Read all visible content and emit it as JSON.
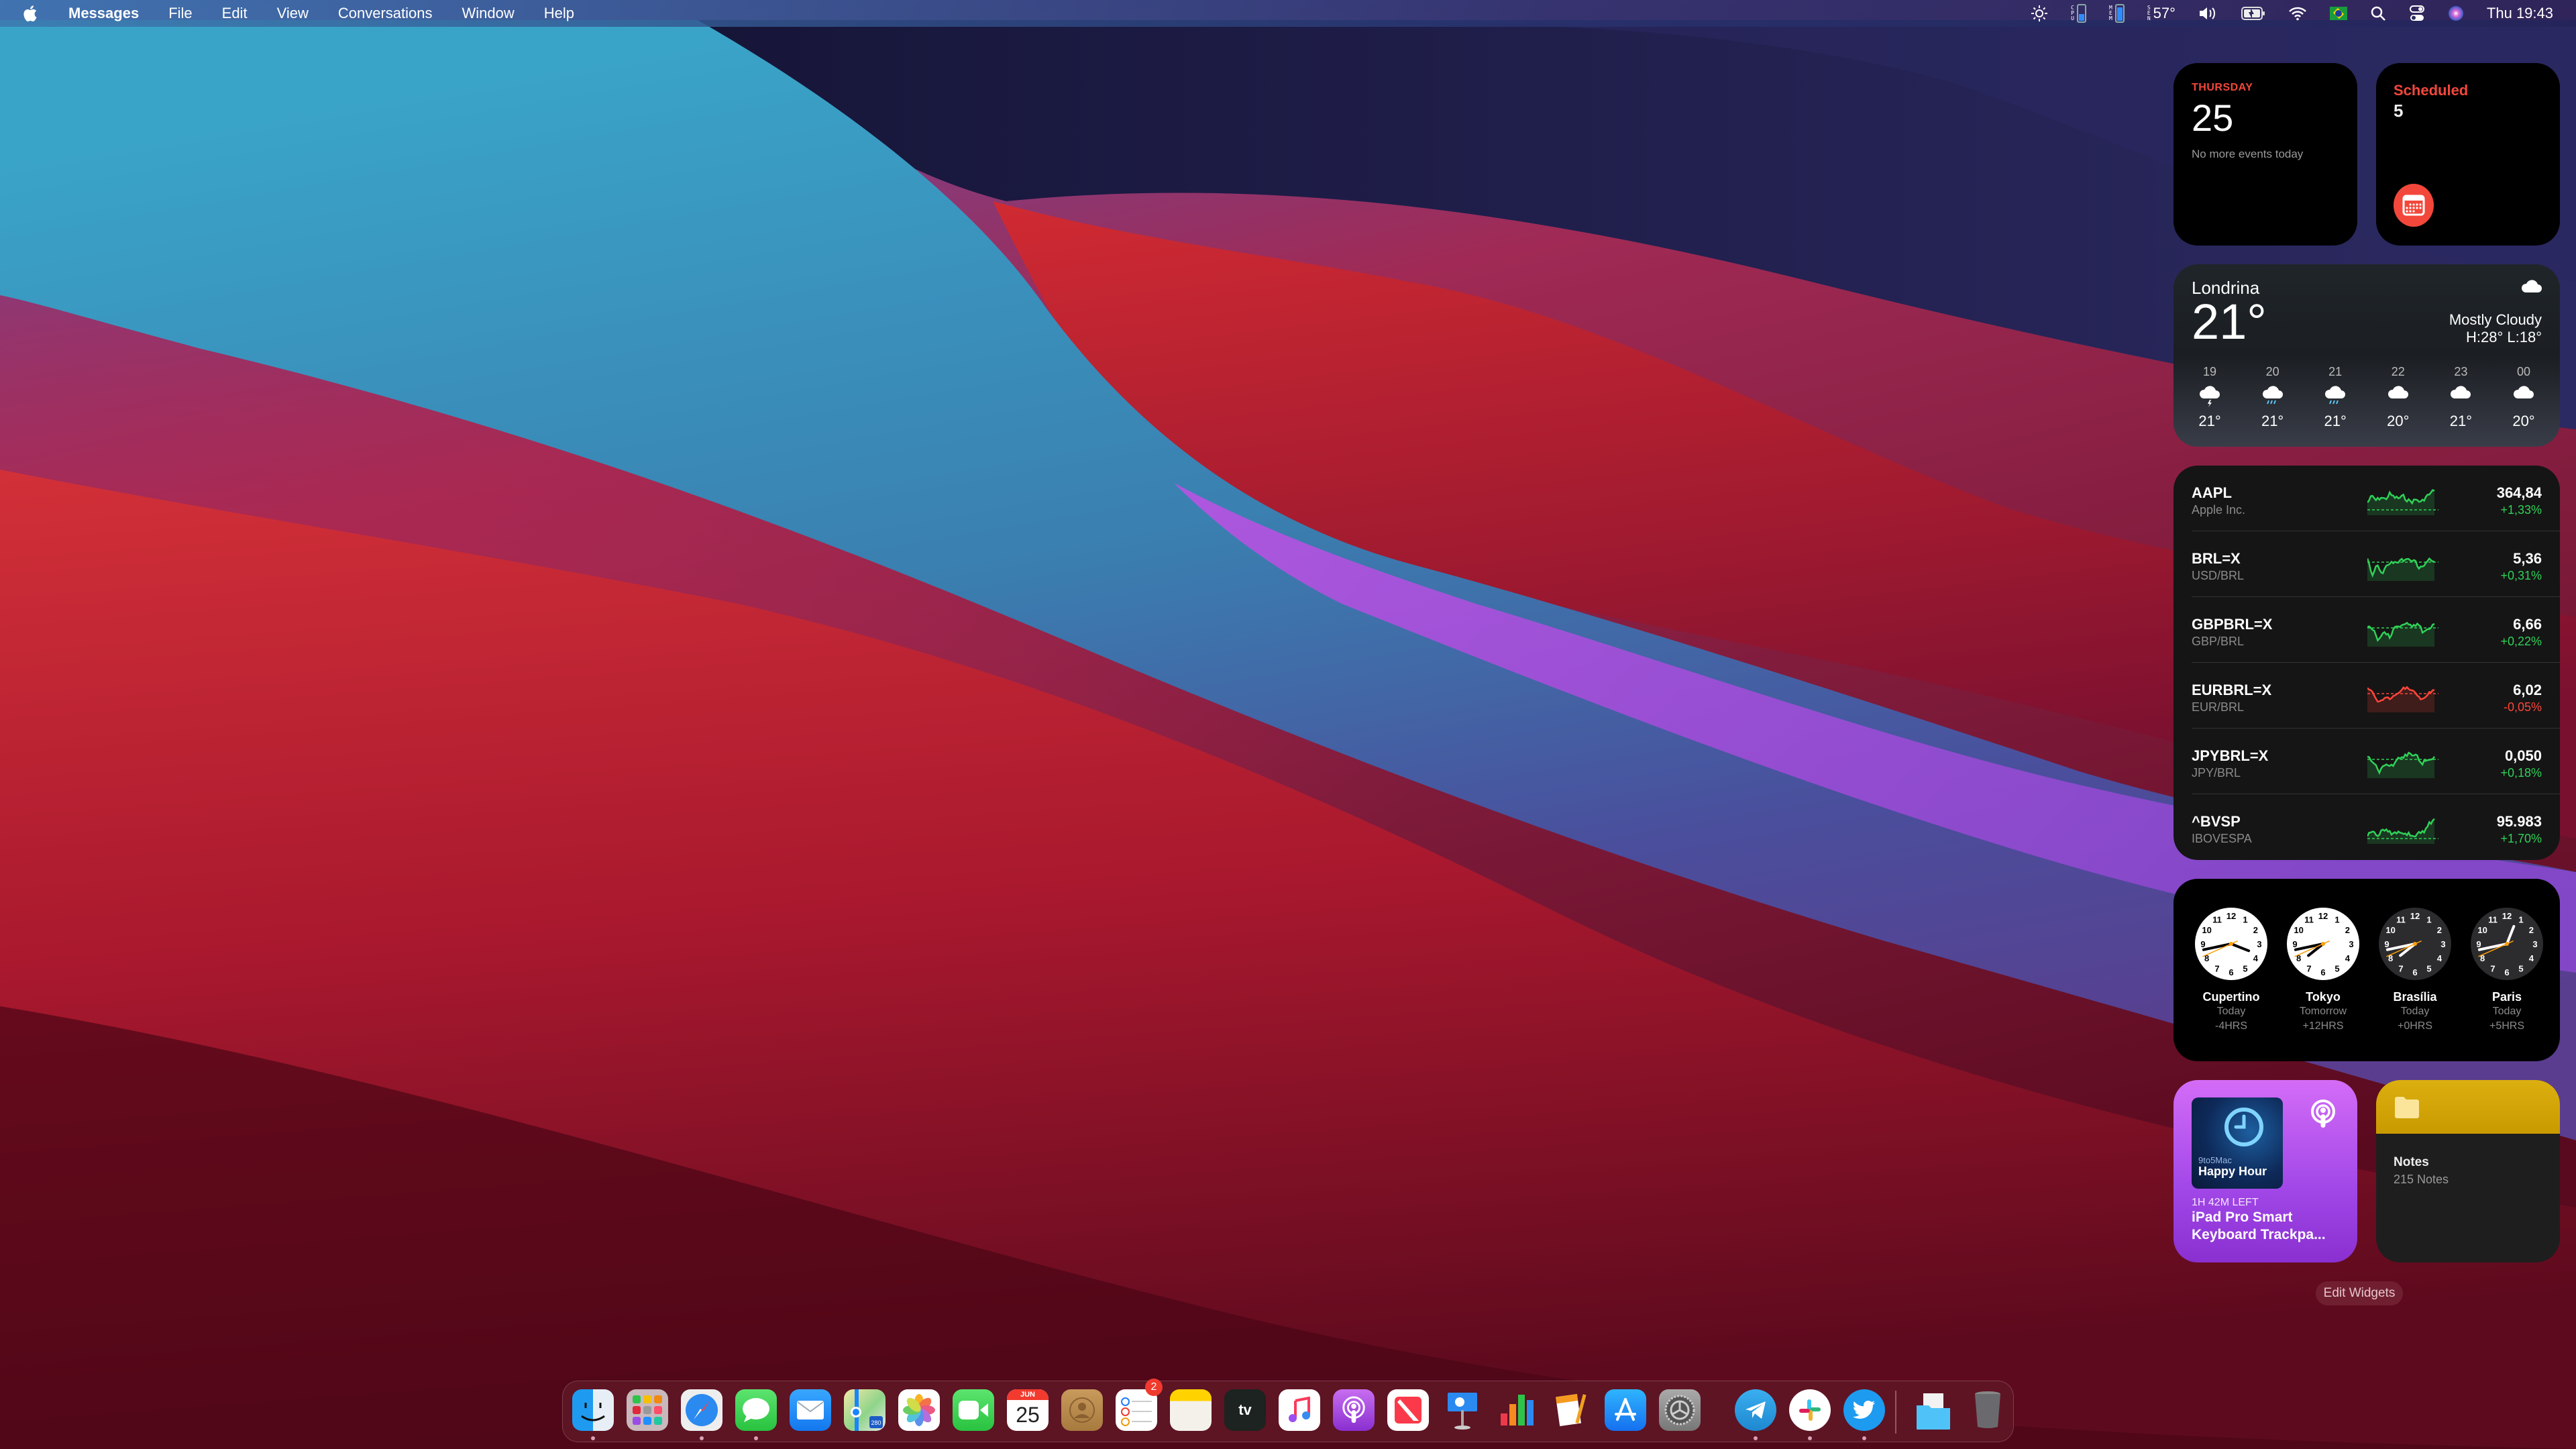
{
  "menubar": {
    "app_name": "Messages",
    "menus": [
      "File",
      "Edit",
      "View",
      "Conversations",
      "Window",
      "Help"
    ],
    "status": {
      "cpu_label": "CPU",
      "mem_label": "MEM",
      "sen_label": "SEN",
      "temperature": "57°",
      "clock": "Thu 19:43"
    },
    "icons": [
      "brightness-icon",
      "cpu-meter-icon",
      "memory-meter-icon",
      "sensor-temp-icon",
      "volume-icon",
      "battery-charging-icon",
      "wifi-icon",
      "brazil-flag-input-icon",
      "spotlight-search-icon",
      "control-center-icon",
      "siri-icon"
    ]
  },
  "widgets": {
    "calendar": {
      "weekday": "THURSDAY",
      "day": "25",
      "subtitle": "No more events today"
    },
    "reminders": {
      "list": "Scheduled",
      "count": "5",
      "accent": "#f3473b"
    },
    "weather": {
      "city": "Londrina",
      "temperature": "21°",
      "condition": "Mostly Cloudy",
      "high_low": "H:28° L:18°",
      "hourly": [
        {
          "hour": "19",
          "icon": "thunderstorm",
          "temp": "21°"
        },
        {
          "hour": "20",
          "icon": "rain",
          "temp": "21°"
        },
        {
          "hour": "21",
          "icon": "rain",
          "temp": "21°"
        },
        {
          "hour": "22",
          "icon": "cloud",
          "temp": "20°"
        },
        {
          "hour": "23",
          "icon": "cloud",
          "temp": "21°"
        },
        {
          "hour": "00",
          "icon": "cloud",
          "temp": "20°"
        }
      ]
    },
    "stocks": {
      "up_color": "#30d158",
      "down_color": "#ff453a",
      "items": [
        {
          "symbol": "AAPL",
          "name": "Apple Inc.",
          "price": "364,84",
          "change": "+1,33%",
          "direction": "up"
        },
        {
          "symbol": "BRL=X",
          "name": "USD/BRL",
          "price": "5,36",
          "change": "+0,31%",
          "direction": "up"
        },
        {
          "symbol": "GBPBRL=X",
          "name": "GBP/BRL",
          "price": "6,66",
          "change": "+0,22%",
          "direction": "up"
        },
        {
          "symbol": "EURBRL=X",
          "name": "EUR/BRL",
          "price": "6,02",
          "change": "-0,05%",
          "direction": "down"
        },
        {
          "symbol": "JPYBRL=X",
          "name": "JPY/BRL",
          "price": "0,050",
          "change": "+0,18%",
          "direction": "up"
        },
        {
          "symbol": "^BVSP",
          "name": "IBOVESPA",
          "price": "95.983",
          "change": "+1,70%",
          "direction": "up"
        }
      ]
    },
    "world_clock": [
      {
        "city": "Cupertino",
        "day": "Today",
        "offset": "-4HRS",
        "theme": "light",
        "hour": 15,
        "minute": 43,
        "second": 41
      },
      {
        "city": "Tokyo",
        "day": "Tomorrow",
        "offset": "+12HRS",
        "theme": "light",
        "hour": 7,
        "minute": 43,
        "second": 41
      },
      {
        "city": "Brasília",
        "day": "Today",
        "offset": "+0HRS",
        "theme": "dark",
        "hour": 19,
        "minute": 43,
        "second": 41
      },
      {
        "city": "Paris",
        "day": "Today",
        "offset": "+5HRS",
        "theme": "dark",
        "hour": 0,
        "minute": 43,
        "second": 41
      }
    ],
    "podcast": {
      "show_small": "9to5Mac",
      "show_title": "Happy Hour",
      "time_left": "1H 42M LEFT",
      "episode": "iPad Pro Smart Keyboard Trackpa..."
    },
    "notes": {
      "folder": "Notes",
      "count": "215 Notes"
    },
    "edit_label": "Edit Widgets"
  },
  "dock": {
    "apps": [
      {
        "name": "Finder",
        "running": true
      },
      {
        "name": "Launchpad",
        "running": false
      },
      {
        "name": "Safari",
        "running": true
      },
      {
        "name": "Messages",
        "running": true
      },
      {
        "name": "Mail",
        "running": false
      },
      {
        "name": "Maps",
        "running": false
      },
      {
        "name": "Photos",
        "running": false
      },
      {
        "name": "FaceTime",
        "running": false
      },
      {
        "name": "Calendar",
        "running": false,
        "month": "JUN",
        "day": "25"
      },
      {
        "name": "Contacts",
        "running": false
      },
      {
        "name": "Reminders",
        "running": false,
        "badge": "2"
      },
      {
        "name": "Notes",
        "running": false
      },
      {
        "name": "TV",
        "running": false
      },
      {
        "name": "Music",
        "running": false
      },
      {
        "name": "Podcasts",
        "running": false
      },
      {
        "name": "News",
        "running": false
      },
      {
        "name": "Keynote",
        "running": false
      },
      {
        "name": "Numbers",
        "running": false
      },
      {
        "name": "Pages",
        "running": false
      },
      {
        "name": "App Store",
        "running": false
      },
      {
        "name": "System Preferences",
        "running": false
      },
      {
        "name": "Telegram",
        "running": true
      },
      {
        "name": "Slack",
        "running": true
      },
      {
        "name": "Twitter",
        "running": true
      }
    ],
    "others": [
      {
        "name": "Downloads"
      },
      {
        "name": "Trash"
      }
    ]
  }
}
